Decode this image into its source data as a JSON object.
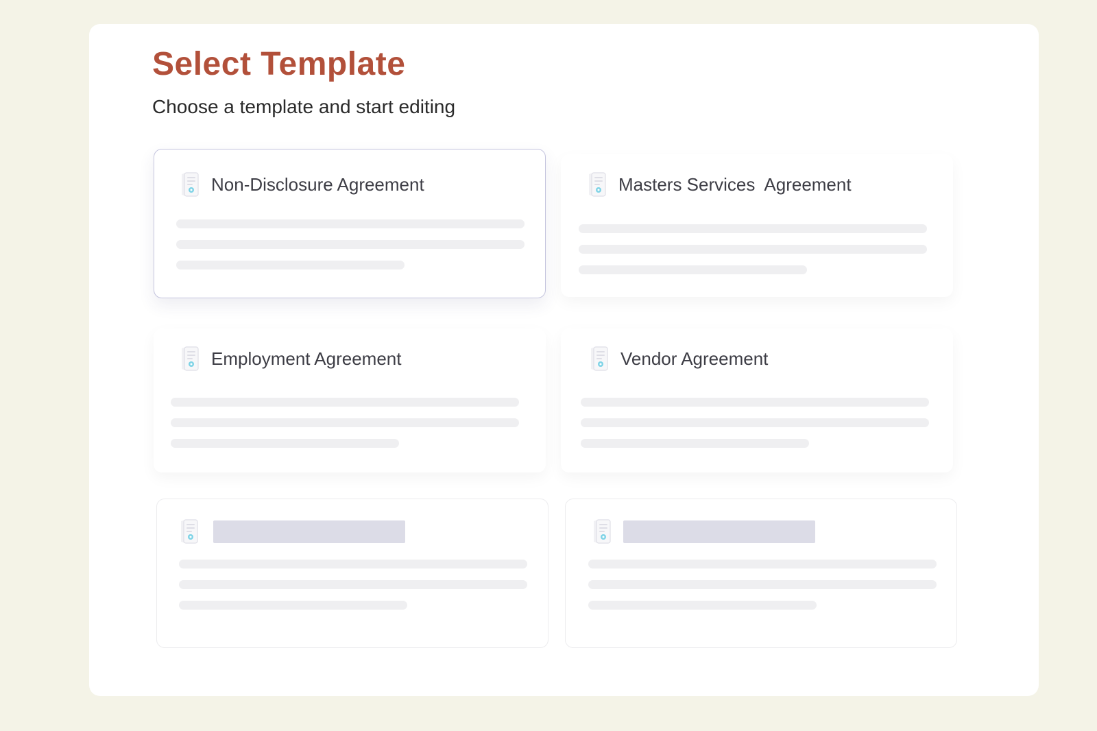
{
  "header": {
    "title": "Select Template",
    "subtitle": "Choose a template and start editing"
  },
  "templates": [
    {
      "title": "Non-Disclosure Agreement",
      "selected": true
    },
    {
      "title": "Masters Services  Agreement",
      "selected": false
    },
    {
      "title": "Employment Agreement",
      "selected": false
    },
    {
      "title": "Vendor Agreement",
      "selected": false
    }
  ],
  "colors": {
    "page_background": "#f4f3e7",
    "panel_background": "#ffffff",
    "title": "#b2503a",
    "selected_border": "#c4c4de",
    "skeleton_line": "#efeff1",
    "skeleton_title": "#dcdce7",
    "icon_accent": "#7fd3e6"
  },
  "icons": {
    "template": "document-icon"
  }
}
